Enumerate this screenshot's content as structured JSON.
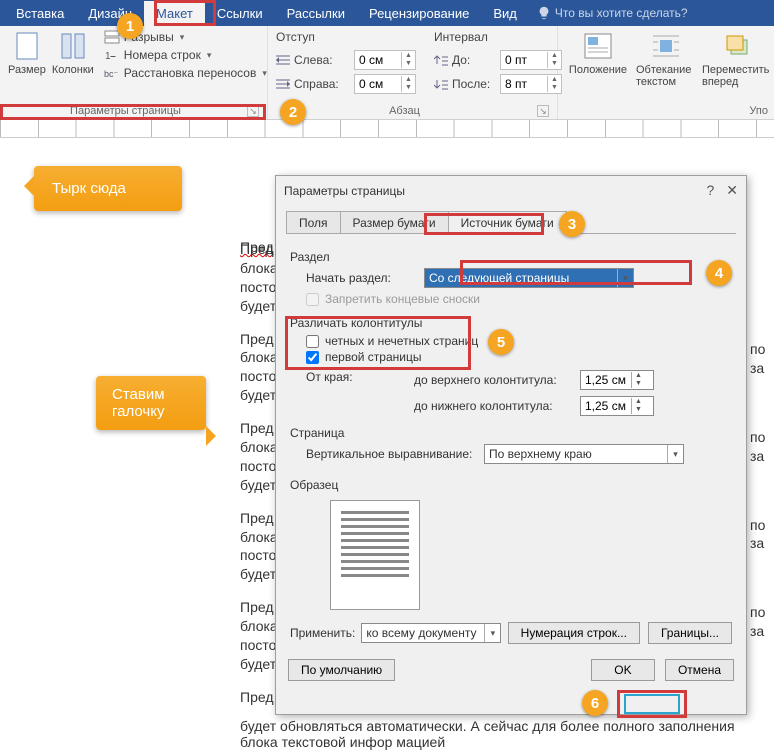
{
  "ribbon": {
    "tabs": [
      "Вставка",
      "Дизайн",
      "Макет",
      "Ссылки",
      "Рассылки",
      "Рецензирование",
      "Вид"
    ],
    "active_tab": "Макет",
    "tell_me": "Что вы хотите сделать?",
    "group_page_setup": "Параметры страницы",
    "group_paragraph": "Абзац",
    "size_label": "Размер",
    "columns_label": "Колонки",
    "breaks_label": "Разрывы",
    "line_numbers": "Номера строк",
    "hyphenation": "Расстановка переносов",
    "indent_title": "Отступ",
    "indent_left_lbl": "Слева:",
    "indent_right_lbl": "Справа:",
    "indent_left": "0 см",
    "indent_right": "0 см",
    "spacing_title": "Интервал",
    "spacing_before_lbl": "До:",
    "spacing_after_lbl": "После:",
    "spacing_before": "0 пт",
    "spacing_after": "8 пт",
    "position_label": "Положение",
    "wrap_label": "Обтекание текстом",
    "forward_label": "Переместить вперед",
    "arrange_group": "Упо"
  },
  "dialog": {
    "title": "Параметры страницы",
    "tabs": {
      "fields": "Поля",
      "size": "Размер бумаги",
      "source": "Источник бумаги"
    },
    "section": "Раздел",
    "section_start_lbl": "Начать раздел:",
    "section_start_val": "Со следующей страницы",
    "suppress_endnotes": "Запретить концевые сноски",
    "headers_footers": "Различать колонтитулы",
    "odd_even": "четных и нечетных страниц",
    "first_page": "первой страницы",
    "from_edge": "От края:",
    "header_dist_lbl": "до верхнего колонтитула:",
    "footer_dist_lbl": "до нижнего колонтитула:",
    "header_dist": "1,25 см",
    "footer_dist": "1,25 см",
    "page": "Страница",
    "valign_lbl": "Вертикальное выравнивание:",
    "valign_val": "По верхнему краю",
    "preview": "Образец",
    "apply_lbl": "Применить:",
    "apply_val": "ко всему документу",
    "line_numbers_btn": "Нумерация строк...",
    "borders_btn": "Границы...",
    "default_btn": "По умолчанию",
    "ok": "OK",
    "cancel": "Отмена"
  },
  "callouts": {
    "c1": "Тырк сюда",
    "c2": "Ставим галочку"
  },
  "doc": {
    "p": "Пред",
    "p2": "блока",
    "p3": "посто",
    "p4": "будет",
    "last": "будет обновляться автоматически. А сейчас для более полного заполнения блока текстовой инфор мацией",
    "tail": "по",
    "tail2": "за"
  }
}
